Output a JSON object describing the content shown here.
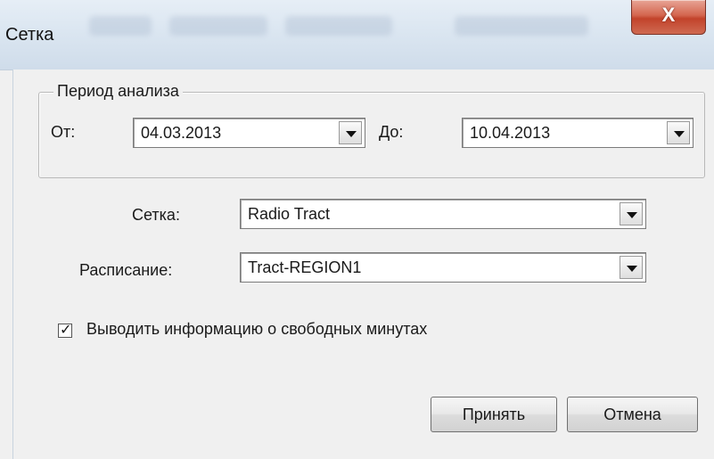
{
  "window": {
    "title": "Сетка",
    "close_label": "X"
  },
  "period": {
    "legend": "Период анализа",
    "from_label": "От:",
    "from_value": "04.03.2013",
    "to_label": "До:",
    "to_value": "10.04.2013"
  },
  "grid": {
    "label": "Сетка:",
    "value": "Radio Tract"
  },
  "schedule": {
    "label": "Расписание:",
    "value": "Tract-REGION1"
  },
  "option": {
    "label": "Выводить информацию о свободных минутах",
    "checked": true,
    "check_glyph": "✓"
  },
  "buttons": {
    "accept": "Принять",
    "cancel": "Отмена"
  }
}
